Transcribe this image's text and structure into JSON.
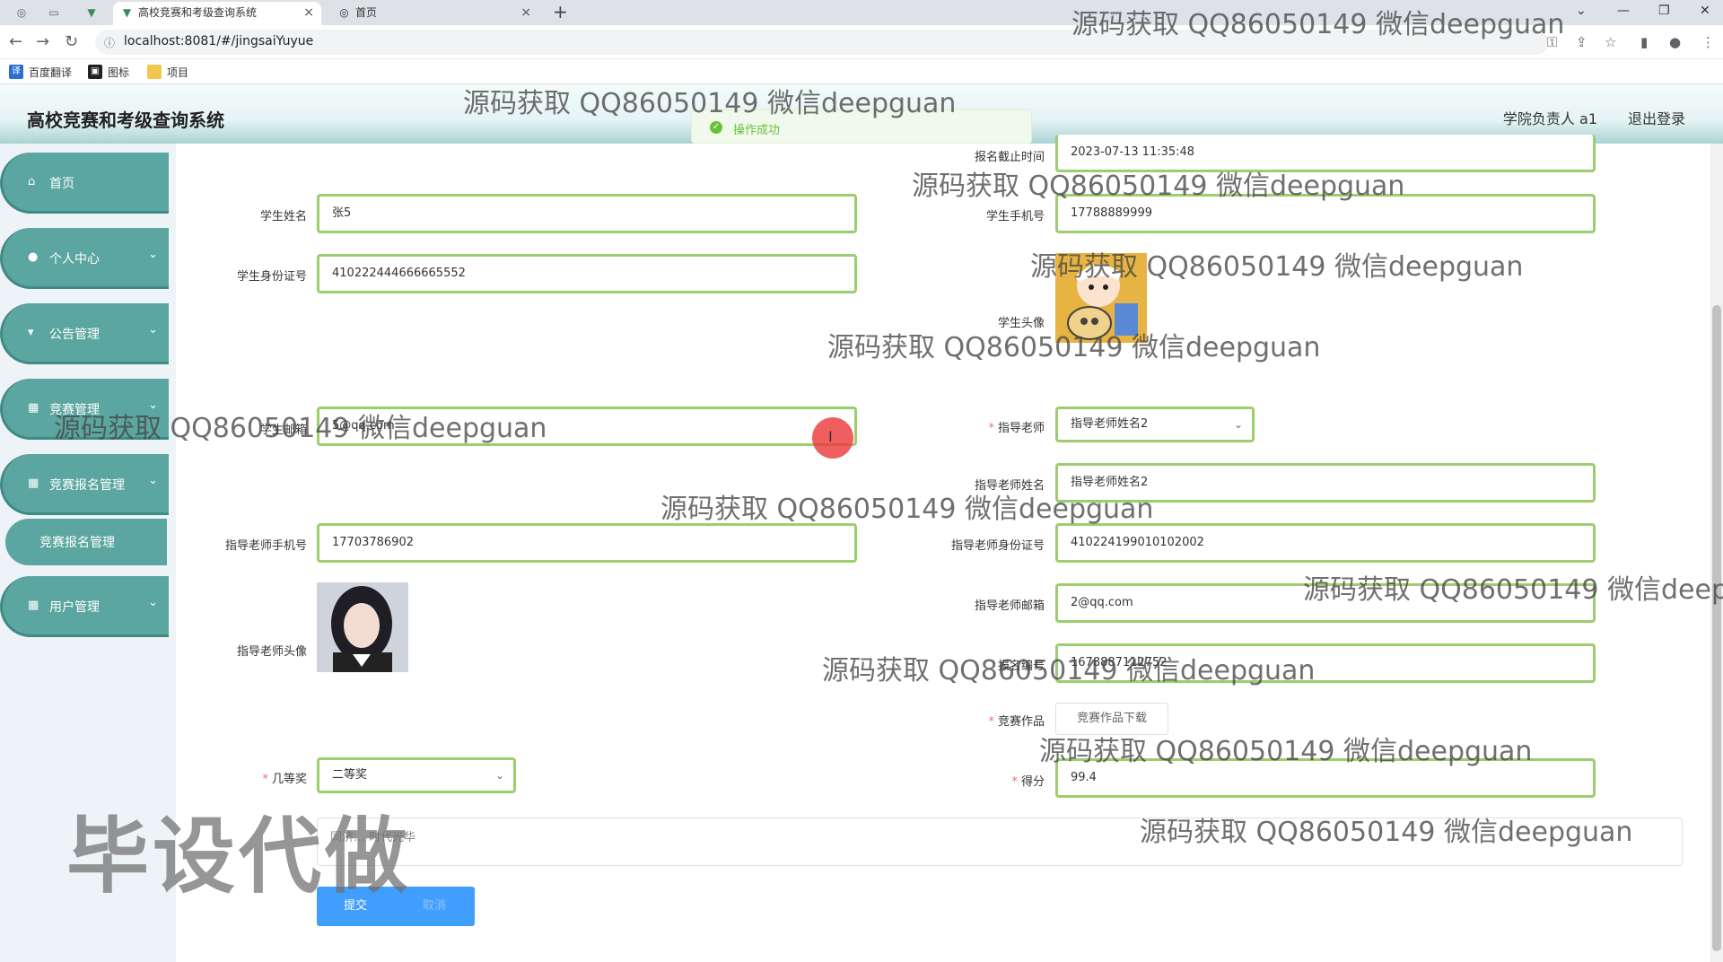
{
  "browser": {
    "tabs": [
      {
        "title": "高校竞赛和考级查询系统",
        "active": true
      },
      {
        "title": "首页",
        "active": false
      }
    ],
    "url": "localhost:8081/#/jingsaiYuyue",
    "bookmarks": [
      "百度翻译",
      "图标",
      "项目"
    ]
  },
  "header": {
    "title": "高校竞赛和考级查询系统",
    "user": "学院负责人 a1",
    "logout": "退出登录"
  },
  "toast": {
    "message": "操作成功"
  },
  "sidebar": {
    "items": [
      {
        "label": "首页",
        "icon": "home-icon"
      },
      {
        "label": "个人中心",
        "icon": "user-icon"
      },
      {
        "label": "公告管理",
        "icon": "announcement-icon"
      },
      {
        "label": "竞赛管理",
        "icon": "grid-icon"
      },
      {
        "label": "竞赛报名管理",
        "icon": "grid-icon"
      },
      {
        "label": "用户管理",
        "icon": "grid-icon"
      }
    ],
    "submenu": "竞赛报名管理"
  },
  "form": {
    "deadline": {
      "label": "报名截止时间",
      "value": "2023-07-13 11:35:48"
    },
    "student_name": {
      "label": "学生姓名",
      "value": "张5"
    },
    "student_phone": {
      "label": "学生手机号",
      "value": "17788889999"
    },
    "student_id": {
      "label": "学生身份证号",
      "value": "410222444666665552"
    },
    "student_avatar": {
      "label": "学生头像"
    },
    "student_email": {
      "label": "学生邮箱",
      "value": "5@qq.com"
    },
    "teacher": {
      "label": "指导老师",
      "value": "指导老师姓名2"
    },
    "teacher_name": {
      "label": "指导老师姓名",
      "value": "指导老师姓名2"
    },
    "teacher_phone": {
      "label": "指导老师手机号",
      "value": "17703786902"
    },
    "teacher_id": {
      "label": "指导老师身份证号",
      "value": "410224199010102002"
    },
    "teacher_avatar": {
      "label": "指导老师头像"
    },
    "teacher_email": {
      "label": "指导老师邮箱",
      "value": "2@qq.com"
    },
    "reg_no": {
      "label": "报名编号",
      "value": "1678887112752"
    },
    "work": {
      "label": "竞赛作品",
      "button": "竞赛作品下载"
    },
    "award": {
      "label": "几等奖",
      "value": "二等奖"
    },
    "score": {
      "label": "得分",
      "value": "99.4"
    },
    "comment": {
      "value": "同济… 时代光华"
    },
    "submit": "提交",
    "cancel": "取消"
  },
  "overlay": {
    "watermark": "源码获取 QQ86050149 微信deepguan",
    "stamp": "毕设代做"
  }
}
